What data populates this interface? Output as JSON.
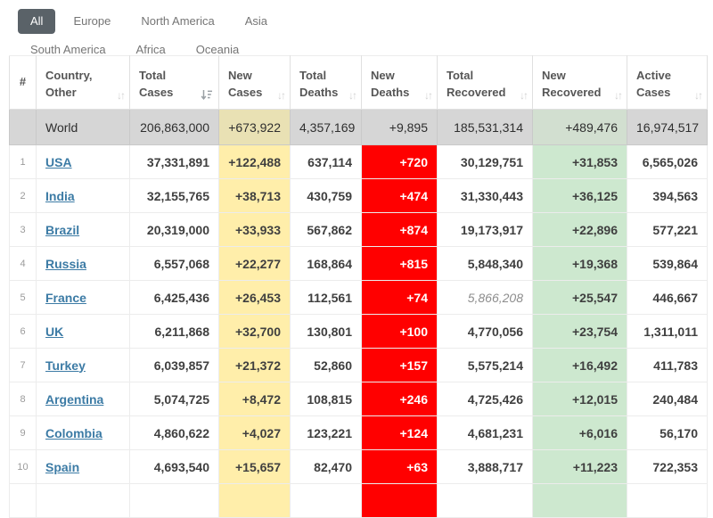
{
  "tabs": [
    {
      "label": "All",
      "active": true
    },
    {
      "label": "Europe",
      "active": false
    },
    {
      "label": "North America",
      "active": false
    },
    {
      "label": "Asia",
      "active": false
    },
    {
      "label": "South America",
      "active": false
    },
    {
      "label": "Africa",
      "active": false
    },
    {
      "label": "Oceania",
      "active": false
    }
  ],
  "colors": {
    "tab_active_bg": "#5A6268",
    "new_cases_bg": "#FFEEAA",
    "new_deaths_bg": "#FF0000",
    "new_recovered_bg": "#CDE8CF",
    "world_bg": "#D6D6D6",
    "link": "#3C7BA5"
  },
  "table": {
    "columns": [
      {
        "label": "#",
        "sort": "none"
      },
      {
        "label": "Country,\nOther",
        "sort": "unsorted"
      },
      {
        "label": "Total\nCases",
        "sort": "desc"
      },
      {
        "label": "New\nCases",
        "sort": "unsorted"
      },
      {
        "label": "Total\nDeaths",
        "sort": "unsorted"
      },
      {
        "label": "New\nDeaths",
        "sort": "unsorted"
      },
      {
        "label": "Total\nRecovered",
        "sort": "unsorted"
      },
      {
        "label": "New\nRecovered",
        "sort": "unsorted"
      },
      {
        "label": "Active\nCases",
        "sort": "unsorted"
      }
    ],
    "world_row": {
      "rank": "",
      "country": "World",
      "total_cases": "206,863,000",
      "new_cases": "+673,922",
      "total_deaths": "4,357,169",
      "new_deaths": "+9,895",
      "total_recovered": "185,531,314",
      "new_recovered": "+489,476",
      "active_cases": "16,974,517"
    },
    "rows": [
      {
        "rank": "1",
        "country": "USA",
        "total_cases": "37,331,891",
        "new_cases": "+122,488",
        "total_deaths": "637,114",
        "new_deaths": "+720",
        "total_recovered": "30,129,751",
        "new_recovered": "+31,853",
        "active_cases": "6,565,026"
      },
      {
        "rank": "2",
        "country": "India",
        "total_cases": "32,155,765",
        "new_cases": "+38,713",
        "total_deaths": "430,759",
        "new_deaths": "+474",
        "total_recovered": "31,330,443",
        "new_recovered": "+36,125",
        "active_cases": "394,563"
      },
      {
        "rank": "3",
        "country": "Brazil",
        "total_cases": "20,319,000",
        "new_cases": "+33,933",
        "total_deaths": "567,862",
        "new_deaths": "+874",
        "total_recovered": "19,173,917",
        "new_recovered": "+22,896",
        "active_cases": "577,221"
      },
      {
        "rank": "4",
        "country": "Russia",
        "total_cases": "6,557,068",
        "new_cases": "+22,277",
        "total_deaths": "168,864",
        "new_deaths": "+815",
        "total_recovered": "5,848,340",
        "new_recovered": "+19,368",
        "active_cases": "539,864"
      },
      {
        "rank": "5",
        "country": "France",
        "total_cases": "6,425,436",
        "new_cases": "+26,453",
        "total_deaths": "112,561",
        "new_deaths": "+74",
        "total_recovered": "5,866,208",
        "total_recovered_muted": true,
        "new_recovered": "+25,547",
        "active_cases": "446,667"
      },
      {
        "rank": "6",
        "country": "UK",
        "total_cases": "6,211,868",
        "new_cases": "+32,700",
        "total_deaths": "130,801",
        "new_deaths": "+100",
        "total_recovered": "4,770,056",
        "new_recovered": "+23,754",
        "active_cases": "1,311,011"
      },
      {
        "rank": "7",
        "country": "Turkey",
        "total_cases": "6,039,857",
        "new_cases": "+21,372",
        "total_deaths": "52,860",
        "new_deaths": "+157",
        "total_recovered": "5,575,214",
        "new_recovered": "+16,492",
        "active_cases": "411,783"
      },
      {
        "rank": "8",
        "country": "Argentina",
        "total_cases": "5,074,725",
        "new_cases": "+8,472",
        "total_deaths": "108,815",
        "new_deaths": "+246",
        "total_recovered": "4,725,426",
        "new_recovered": "+12,015",
        "active_cases": "240,484"
      },
      {
        "rank": "9",
        "country": "Colombia",
        "total_cases": "4,860,622",
        "new_cases": "+4,027",
        "total_deaths": "123,221",
        "new_deaths": "+124",
        "total_recovered": "4,681,231",
        "new_recovered": "+6,016",
        "active_cases": "56,170"
      },
      {
        "rank": "10",
        "country": "Spain",
        "total_cases": "4,693,540",
        "new_cases": "+15,657",
        "total_deaths": "82,470",
        "new_deaths": "+63",
        "total_recovered": "3,888,717",
        "new_recovered": "+11,223",
        "active_cases": "722,353"
      }
    ]
  }
}
